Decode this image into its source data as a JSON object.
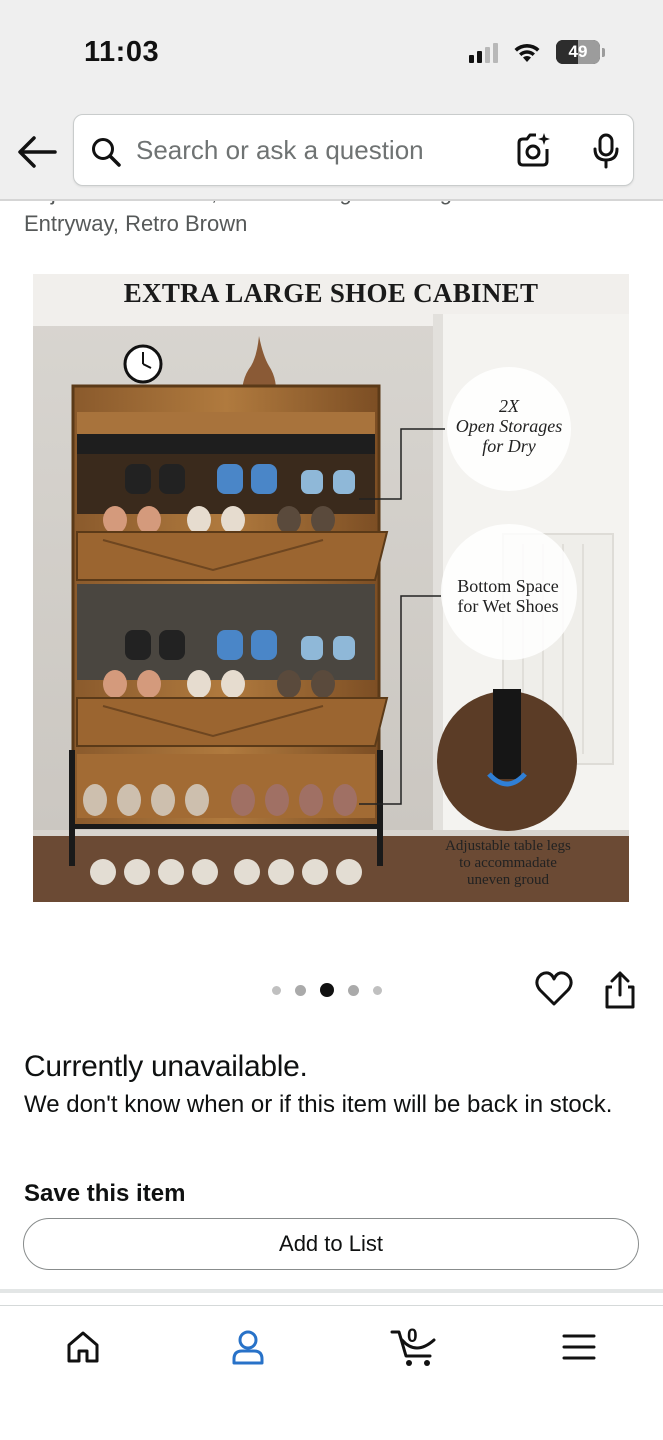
{
  "status_bar": {
    "time": "11:03",
    "battery": "49"
  },
  "header": {
    "search_placeholder": "Search or ask a question",
    "icons": [
      "back-arrow-icon",
      "search-icon",
      "camera-icon",
      "mic-icon"
    ]
  },
  "product": {
    "title_partial": "Adjustable Shelves, Freestanding Shoe Organizer for Entryway, Retro Brown",
    "image": {
      "headline": "EXTRA LARGE SHOE CABINET",
      "callout_1": [
        "2X",
        "Open Storages",
        "for Dry"
      ],
      "callout_2": [
        "Bottom Space",
        "for Wet Shoes"
      ],
      "callout_3": [
        "Adjustable table legs",
        "to accommadate",
        "uneven groud"
      ]
    },
    "carousel": {
      "count": 5,
      "active_index": 2
    }
  },
  "availability": {
    "status": "Currently unavailable.",
    "description": "We don't know when or if this item will be back in stock."
  },
  "save": {
    "heading": "Save this item",
    "add_to_list": "Add to List"
  },
  "bottom_nav": {
    "items": [
      "home-icon",
      "account-icon",
      "cart-icon",
      "menu-icon"
    ],
    "cart_count": "0",
    "active": "account",
    "accent": "#2872c8"
  }
}
